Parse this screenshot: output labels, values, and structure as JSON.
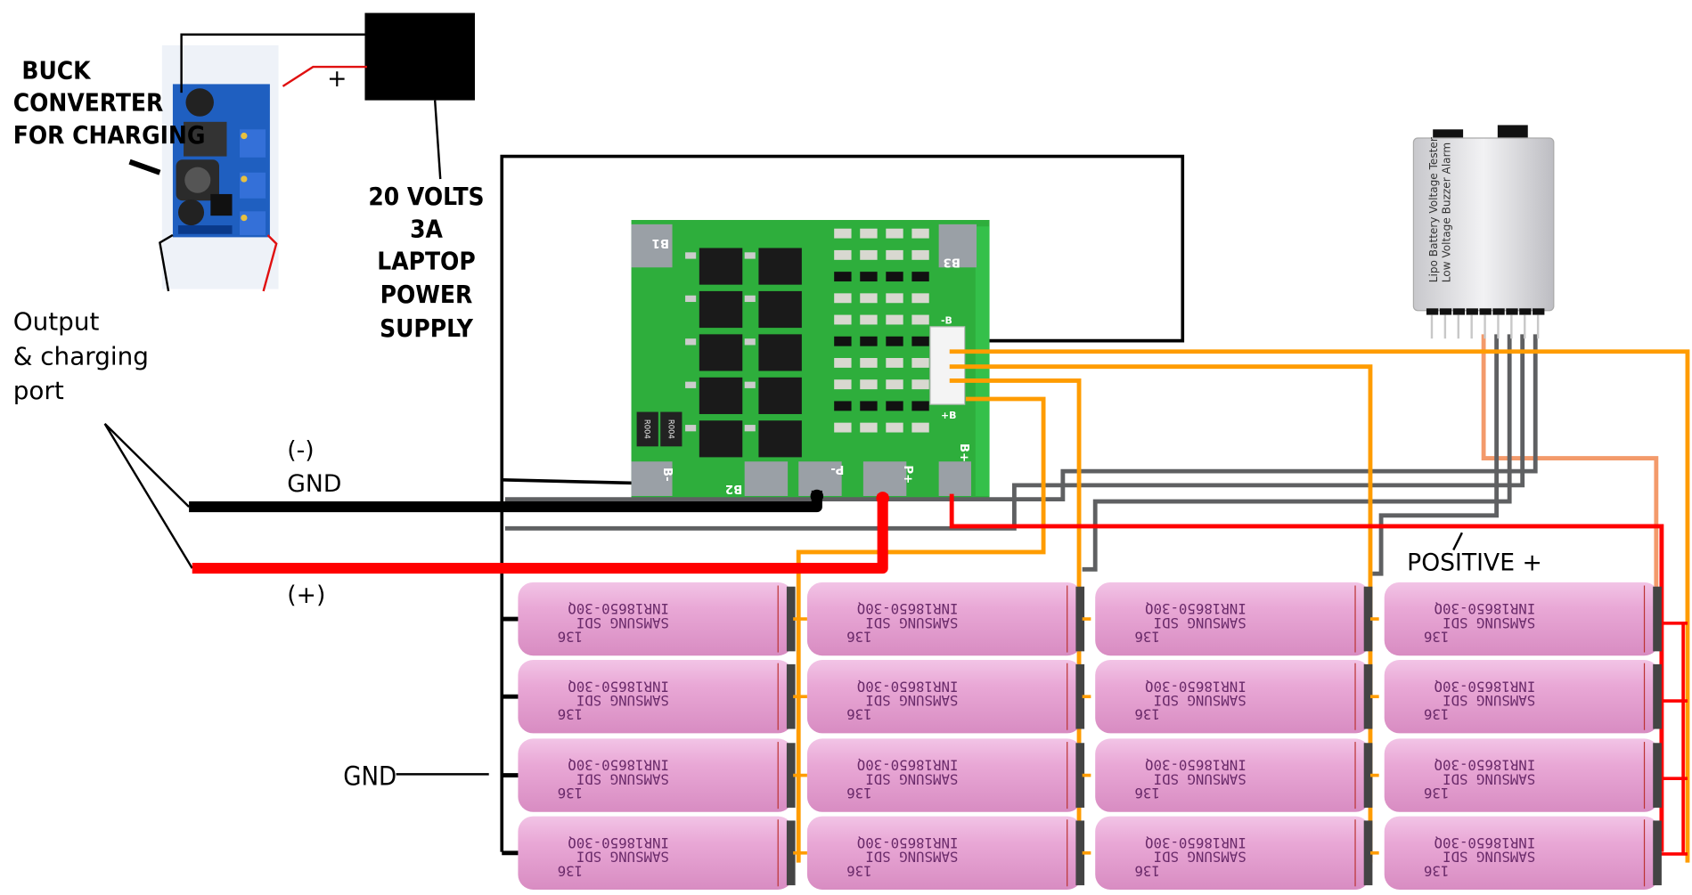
{
  "labels": {
    "buck_line1": "BUCK",
    "buck_line2": "CONVERTER",
    "buck_line3": "FOR CHARGING",
    "psu_line1": "20 VOLTS",
    "psu_line2": "3A",
    "psu_line3": "LAPTOP",
    "psu_line4": "POWER",
    "psu_line5": "SUPPLY",
    "plus_sign": "+",
    "port_line1": "Output",
    "port_line2": "& charging",
    "port_line3": "port",
    "neg_sign": "(-)",
    "neg_gnd": "GND",
    "pos_sign": "(+)",
    "gnd_bus": "GND",
    "positive": "POSITIVE +"
  },
  "bms": {
    "pads": [
      "B1",
      "B3",
      "B2",
      "B-",
      "P-",
      "P+",
      "B+"
    ],
    "connector_labels": [
      "-B",
      "+B"
    ],
    "shunt": "R004"
  },
  "tester": {
    "title1": "Lipo Battery Voltage Tester",
    "title2": "Low Voltage Buzzer Alarm"
  },
  "cell": {
    "line1": "136",
    "line2": "SAMSUNG  SDI",
    "line3": "INR18650-30Q",
    "rows": 4,
    "cols": 4
  },
  "colors": {
    "gnd_wire": "#000000",
    "positive_wire": "#ff0000",
    "balance_wire": "#ff9c00",
    "sense_wire": "#5f6062",
    "sense_wire_top": "#f39a6b",
    "pcb_green": "#2eae3c",
    "cell_pink": "#e9a3d4"
  }
}
